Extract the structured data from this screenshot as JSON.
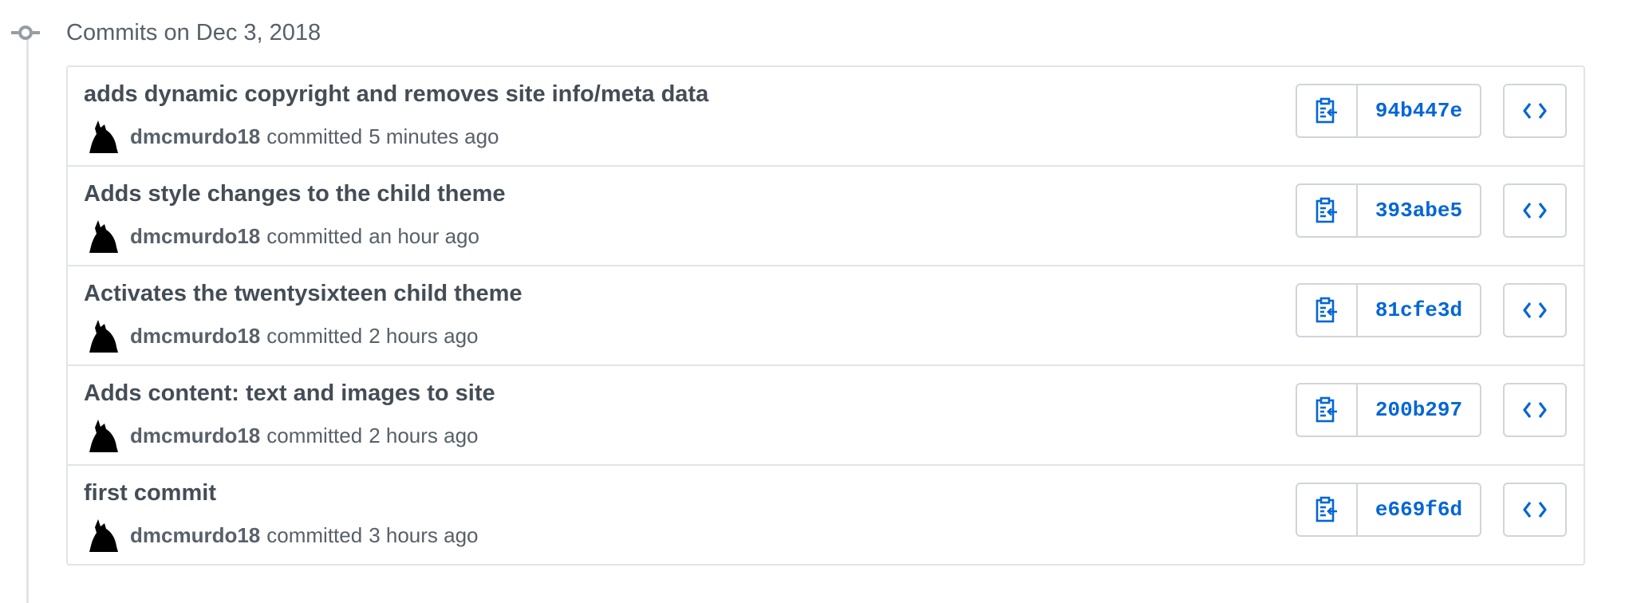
{
  "timeline": {
    "day_title": "Commits on Dec 3, 2018"
  },
  "colors": {
    "link_blue": "#0366d6",
    "border": "#e1e4e8",
    "muted_text": "#586069",
    "title_text": "#444d56"
  },
  "commits": [
    {
      "title": "adds dynamic copyright and removes site info/meta data",
      "author": "dmcmurdo18",
      "verb": "committed",
      "time": "5 minutes ago",
      "sha": "94b447e"
    },
    {
      "title": "Adds style changes to the child theme",
      "author": "dmcmurdo18",
      "verb": "committed",
      "time": "an hour ago",
      "sha": "393abe5"
    },
    {
      "title": "Activates the twentysixteen child theme",
      "author": "dmcmurdo18",
      "verb": "committed",
      "time": "2 hours ago",
      "sha": "81cfe3d"
    },
    {
      "title": "Adds content: text and images to site",
      "author": "dmcmurdo18",
      "verb": "committed",
      "time": "2 hours ago",
      "sha": "200b297"
    },
    {
      "title": "first commit",
      "author": "dmcmurdo18",
      "verb": "committed",
      "time": "3 hours ago",
      "sha": "e669f6d"
    }
  ],
  "icons": {
    "timeline": "git-commit-icon",
    "avatar": "wolf-silhouette-avatar",
    "copy": "clippy-icon",
    "browse": "code-icon"
  }
}
